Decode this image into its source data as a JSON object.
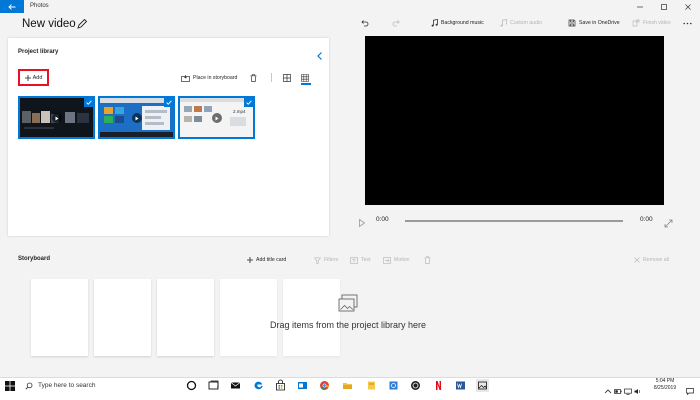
{
  "window": {
    "app_name": "Photos",
    "page_title": "New video"
  },
  "toolbar": {
    "background_music": "Background music",
    "custom_audio": "Custom audio",
    "save_onedrive": "Save in OneDrive",
    "finish_video": "Finish video"
  },
  "library": {
    "title": "Project library",
    "add_label": "Add",
    "place_in_storyboard": "Place in storyboard",
    "thumbnail_tag": "2.mp4"
  },
  "preview": {
    "current_time": "0:00",
    "end_time": "0:00"
  },
  "storyboard": {
    "title": "Storyboard",
    "add_title_card": "Add title card",
    "filters": "Filters",
    "text": "Text",
    "motion": "Motion",
    "remove_all": "Remove all",
    "empty_message": "Drag items from the project library here"
  },
  "taskbar": {
    "search_placeholder": "Type here to search",
    "time": "5:04 PM",
    "date": "8/25/2019"
  },
  "colors": {
    "accent": "#0078d7",
    "highlight_border": "#e81123",
    "preview_bg": "#000000",
    "panel_bg": "#f3f3f3"
  }
}
